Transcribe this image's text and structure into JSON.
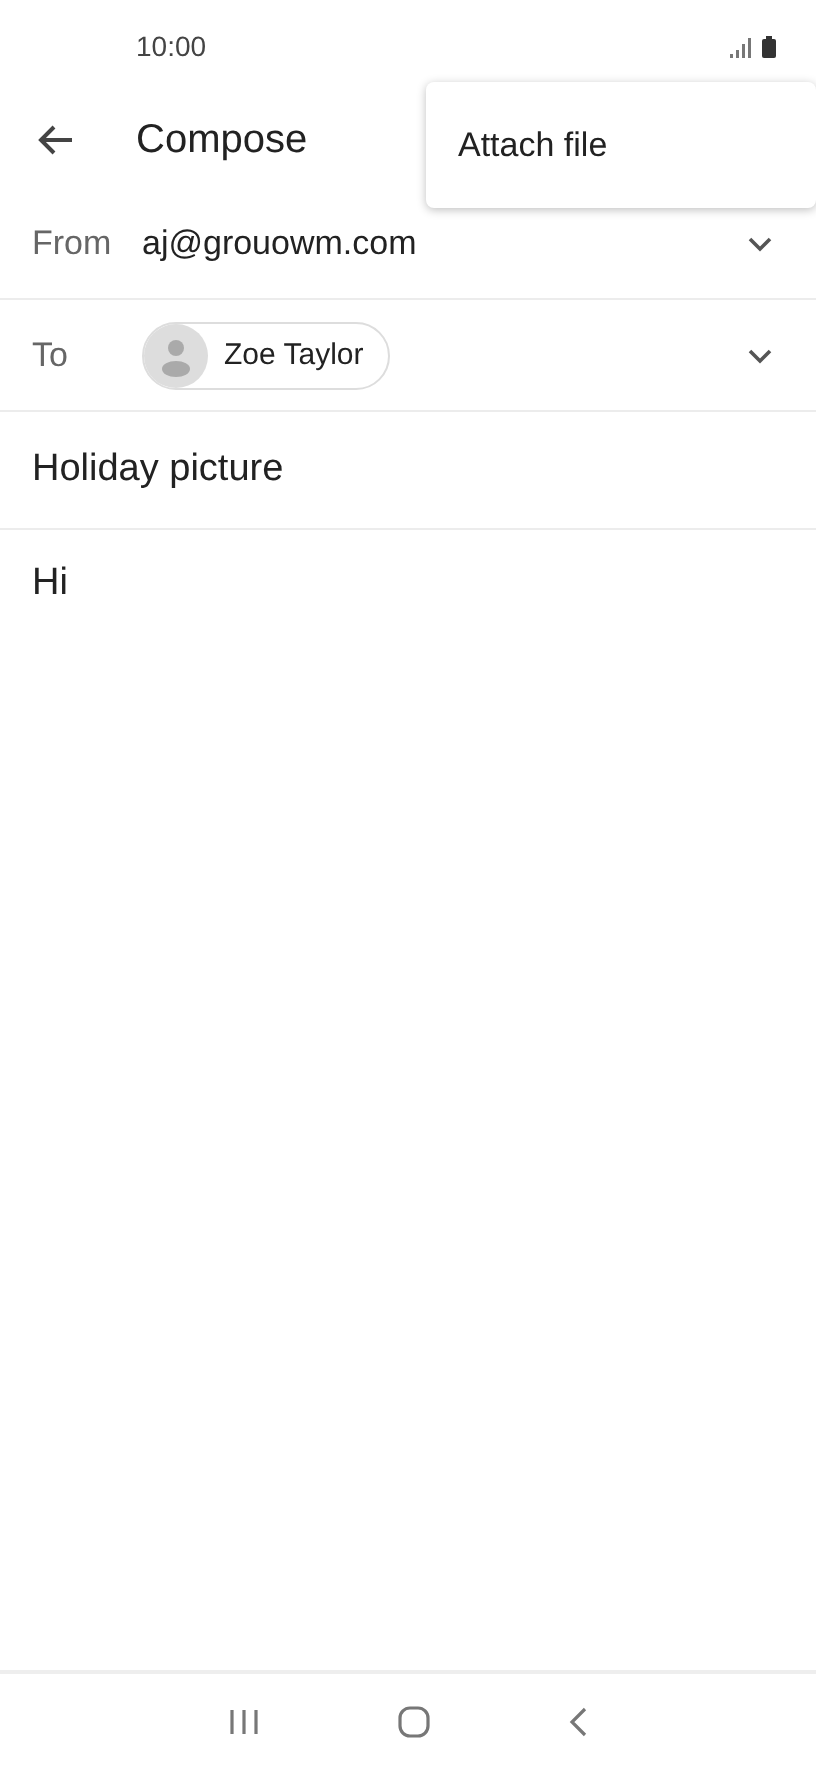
{
  "status_bar": {
    "time": "10:00"
  },
  "app_bar": {
    "title": "Compose"
  },
  "menu": {
    "items": [
      "Attach file"
    ]
  },
  "from": {
    "label": "From",
    "value": "aj@grouowm.com"
  },
  "to": {
    "label": "To",
    "recipients": [
      "Zoe Taylor"
    ]
  },
  "subject": {
    "value": "Holiday picture"
  },
  "body": {
    "value": "Hi"
  }
}
